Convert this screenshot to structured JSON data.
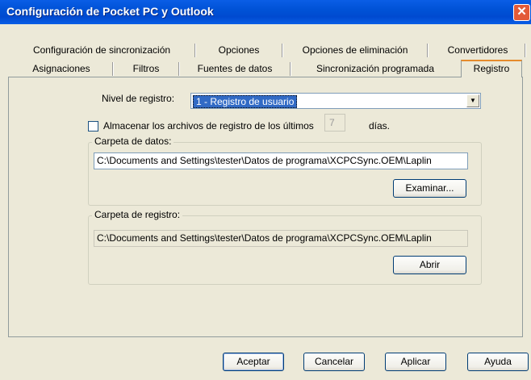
{
  "window": {
    "title": "Configuración de Pocket PC y Outlook"
  },
  "tabs": {
    "row1": [
      "Configuración de sincronización",
      "Opciones",
      "Opciones de eliminación",
      "Convertidores"
    ],
    "row2": [
      "Asignaciones",
      "Filtros",
      "Fuentes de datos",
      "Sincronización programada"
    ],
    "active": "Registro"
  },
  "log_level": {
    "label": "Nivel de registro:",
    "value": "1 - Registro de usuario"
  },
  "store_logs": {
    "label": "Almacenar los archivos de registro de los últimos",
    "days_value": "7",
    "days_suffix": "días.",
    "checked": false
  },
  "data_folder": {
    "label": "Carpeta de datos:",
    "path": "C:\\Documents and Settings\\tester\\Datos de programa\\XCPCSync.OEM\\Laplin",
    "browse": "Examinar..."
  },
  "log_folder": {
    "label": "Carpeta de registro:",
    "path": "C:\\Documents and Settings\\tester\\Datos de programa\\XCPCSync.OEM\\Laplin",
    "open": "Abrir"
  },
  "buttons": {
    "ok": "Aceptar",
    "cancel": "Cancelar",
    "apply": "Aplicar",
    "help": "Ayuda"
  },
  "colors": {
    "titlebar": "#0054e3",
    "face": "#ece9d8",
    "selection": "#316ac5",
    "active_tab_accent": "#e68b2c"
  }
}
